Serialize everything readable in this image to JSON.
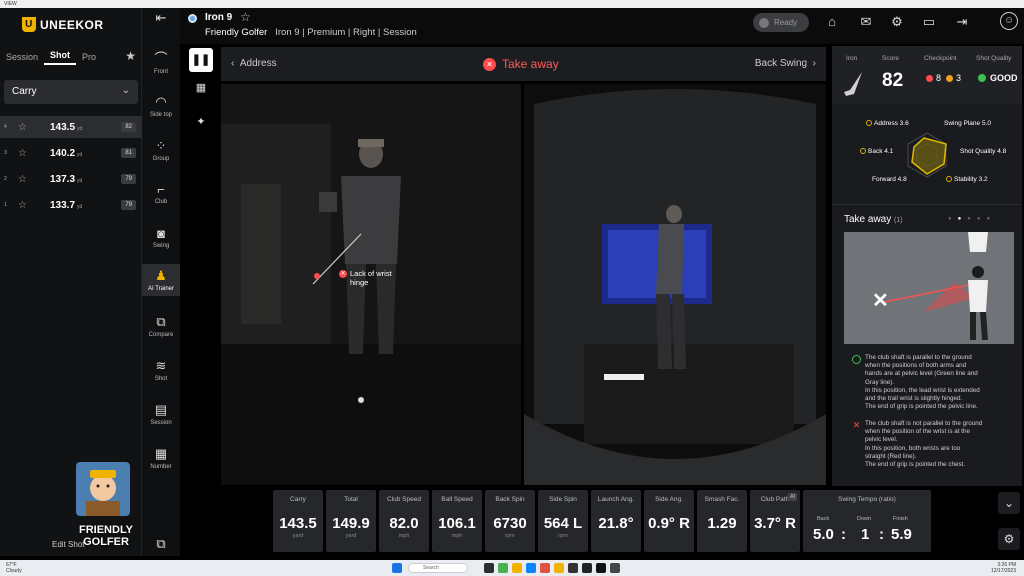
{
  "window": {
    "title": "VIEW"
  },
  "brand": {
    "name": "UNEEKOR",
    "mark": "U"
  },
  "left_tabs": {
    "items": [
      "Session",
      "Shot",
      "Pro"
    ],
    "active": "Shot"
  },
  "carry_select": {
    "value": "Carry"
  },
  "shots": [
    {
      "num": "4",
      "distance": "143.5",
      "unit": "yd",
      "badge": "82",
      "selected": true
    },
    {
      "num": "3",
      "distance": "140.2",
      "unit": "yd",
      "badge": "81",
      "selected": false
    },
    {
      "num": "2",
      "distance": "137.3",
      "unit": "yd",
      "badge": "79",
      "selected": false
    },
    {
      "num": "1",
      "distance": "133.7",
      "unit": "yd",
      "badge": "79",
      "selected": false
    }
  ],
  "edit_shot": "Edit Shot",
  "watermark": {
    "line1": "FRIENDLY",
    "line2": "GOLFER"
  },
  "icon_menu": [
    {
      "label": "Front",
      "icon": "club-front-icon",
      "glyph": "⌒"
    },
    {
      "label": "Side top",
      "icon": "side-top-icon",
      "glyph": "◠"
    },
    {
      "label": "Group",
      "icon": "group-icon",
      "glyph": "⁘"
    },
    {
      "label": "Club",
      "icon": "club-icon",
      "glyph": "⌐"
    },
    {
      "label": "Swing",
      "icon": "camera-icon",
      "glyph": "◙"
    },
    {
      "label": "AI Trainer",
      "icon": "ai-trainer-icon",
      "glyph": "♟"
    },
    {
      "label": "Compare",
      "icon": "compare-icon",
      "glyph": "⧉"
    },
    {
      "label": "Shot",
      "icon": "shot-icon",
      "glyph": "≋"
    },
    {
      "label": "Session",
      "icon": "session-icon",
      "glyph": "▤"
    },
    {
      "label": "Number",
      "icon": "number-icon",
      "glyph": "▦"
    }
  ],
  "header": {
    "club": "Iron 9",
    "player": "Friendly Golfer",
    "club_sub": "Iron 9",
    "tier": "Premium",
    "hand": "Right",
    "mode": "Session",
    "status": "Ready"
  },
  "nav": {
    "prev": "Address",
    "current": "Take away",
    "next": "Back Swing"
  },
  "annotation": {
    "line1": "Lack of wrist",
    "line2": "hinge"
  },
  "score_panel": {
    "club_label": "Iron",
    "score_label": "Score",
    "score": "82",
    "checkpoint_label": "Checkpoint",
    "checkpoint_red": "8",
    "checkpoint_orange": "3",
    "quality_label": "Shot Quality",
    "quality": "GOOD"
  },
  "radar": {
    "labels": [
      {
        "name": "Address",
        "value": "3.6"
      },
      {
        "name": "Swing Plane",
        "value": "5.0"
      },
      {
        "name": "Back",
        "value": "4.1"
      },
      {
        "name": "Shot Quality",
        "value": "4.8"
      },
      {
        "name": "Forward",
        "value": "4.8"
      },
      {
        "name": "Stability",
        "value": "3.2"
      }
    ],
    "color": "#e0b800"
  },
  "takeaway": {
    "title": "Take away",
    "count": "(1)",
    "good_text": [
      "The club shaft is parallel to the ground",
      "when the positions of both arms and",
      "hands are at pelvic level (Green line and",
      "Gray line).",
      "In this position, the lead wrist is extended",
      "and the trail wrist is slightly hinged.",
      "The end of grip is pointed the pelvic line."
    ],
    "bad_text": [
      "The club shaft is not parallel to the ground",
      "when the position of the wrist is at the",
      "pelvic level.",
      "In this position, both wrists are too",
      "straight (Red line).",
      "The end of grip is pointed the chest."
    ]
  },
  "metrics": [
    {
      "label": "Carry",
      "value": "143.5",
      "unit": "yard"
    },
    {
      "label": "Total",
      "value": "149.9",
      "unit": "yard"
    },
    {
      "label": "Club Speed",
      "value": "82.0",
      "unit": "mph"
    },
    {
      "label": "Ball Speed",
      "value": "106.1",
      "unit": "mph"
    },
    {
      "label": "Back Spin",
      "value": "6730",
      "unit": "rpm"
    },
    {
      "label": "Side Spin",
      "value": "564 L",
      "unit": "rpm"
    },
    {
      "label": "Launch Ang.",
      "value": "21.8°",
      "unit": ""
    },
    {
      "label": "Side Ang.",
      "value": "0.9° R",
      "unit": ""
    },
    {
      "label": "Smash Fac.",
      "value": "1.29",
      "unit": ""
    },
    {
      "label": "Club Path",
      "value": "3.7° R",
      "unit": "",
      "ai": "AI"
    }
  ],
  "tempo": {
    "label": "Swing Tempo (ratio)",
    "back_label": "Back",
    "down_label": "Down",
    "finish_label": "Finish",
    "back": "5.0",
    "down": "1",
    "finish": "5.9",
    "sep": ":"
  },
  "taskbar": {
    "search": "Search",
    "weather_temp": "67°F",
    "weather_desc": "Cloudy",
    "time": "3:26 PM",
    "date": "12/17/2023"
  },
  "colors": {
    "accent": "#f0b400",
    "alert": "#ff4b4b",
    "good": "#3ec14a"
  }
}
